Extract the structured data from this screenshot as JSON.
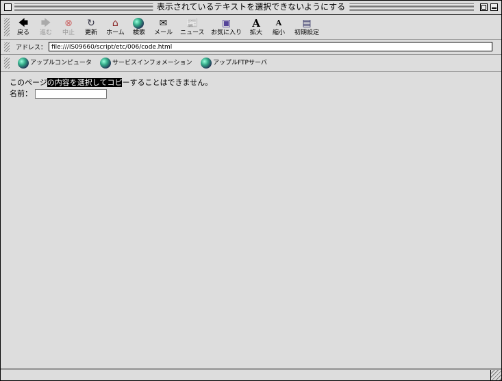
{
  "window": {
    "title": "表示されているテキストを選択できないようにする"
  },
  "toolbar": {
    "buttons": [
      {
        "label": "戻る",
        "icon": "back-arrow-icon",
        "enabled": true
      },
      {
        "label": "進む",
        "icon": "forward-arrow-icon",
        "enabled": false
      },
      {
        "label": "中止",
        "icon": "stop-icon",
        "enabled": false
      },
      {
        "label": "更新",
        "icon": "refresh-icon",
        "enabled": true
      },
      {
        "label": "ホーム",
        "icon": "home-icon",
        "enabled": true
      },
      {
        "label": "検索",
        "icon": "search-globe-icon",
        "enabled": true
      },
      {
        "label": "メール",
        "icon": "mail-icon",
        "enabled": true
      },
      {
        "label": "ニュース",
        "icon": "news-icon",
        "enabled": true
      },
      {
        "label": "お気に入り",
        "icon": "favorites-icon",
        "enabled": true
      },
      {
        "label": "拡大",
        "icon": "text-larger-icon",
        "enabled": true
      },
      {
        "label": "縮小",
        "icon": "text-smaller-icon",
        "enabled": true
      },
      {
        "label": "初期設定",
        "icon": "preferences-icon",
        "enabled": true
      }
    ]
  },
  "address": {
    "label": "アドレス：",
    "url": "file:///IS09660/script/etc/006/code.html"
  },
  "favorites": [
    {
      "label": "アップルコンピュータ"
    },
    {
      "label": "サービスインフォメーション"
    },
    {
      "label": "アップルFTPサーバ"
    }
  ],
  "content": {
    "line1_before": "このページ",
    "line1_selected": "の内容を選択してコピ",
    "line1_after": "ーすることはできません。",
    "name_label": "名前："
  }
}
